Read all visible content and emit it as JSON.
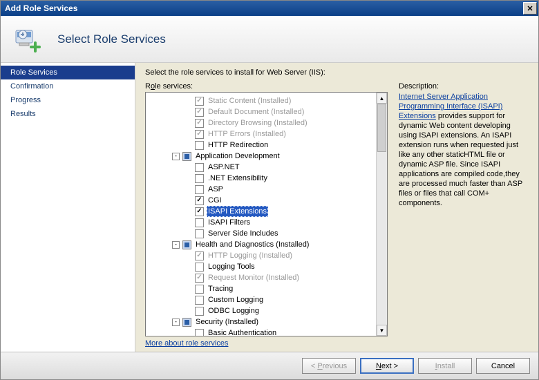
{
  "window": {
    "title": "Add Role Services"
  },
  "header": {
    "title": "Select Role Services"
  },
  "sidebar": {
    "items": [
      {
        "label": "Role Services",
        "active": true
      },
      {
        "label": "Confirmation",
        "active": false
      },
      {
        "label": "Progress",
        "active": false
      },
      {
        "label": "Results",
        "active": false
      }
    ]
  },
  "main": {
    "instruction": "Select the role services to install for Web Server (IIS):",
    "tree_label_pre": "R",
    "tree_label_u": "o",
    "tree_label_post": "le services:",
    "more_link": "More about role services"
  },
  "tree": {
    "nodes": [
      {
        "indent": 3,
        "label": "Static Content  (Installed)",
        "state": "checked",
        "disabled": true
      },
      {
        "indent": 3,
        "label": "Default Document  (Installed)",
        "state": "checked",
        "disabled": true
      },
      {
        "indent": 3,
        "label": "Directory Browsing  (Installed)",
        "state": "checked",
        "disabled": true
      },
      {
        "indent": 3,
        "label": "HTTP Errors  (Installed)",
        "state": "checked",
        "disabled": true
      },
      {
        "indent": 3,
        "label": "HTTP Redirection",
        "state": "unchecked",
        "disabled": false
      },
      {
        "indent": 2,
        "label": "Application Development",
        "state": "tri",
        "disabled": false,
        "expander": "-"
      },
      {
        "indent": 3,
        "label": "ASP.NET",
        "state": "unchecked",
        "disabled": false
      },
      {
        "indent": 3,
        "label": ".NET Extensibility",
        "state": "unchecked",
        "disabled": false
      },
      {
        "indent": 3,
        "label": "ASP",
        "state": "unchecked",
        "disabled": false
      },
      {
        "indent": 3,
        "label": "CGI",
        "state": "checked",
        "disabled": false
      },
      {
        "indent": 3,
        "label": "ISAPI Extensions",
        "state": "checked",
        "disabled": false,
        "selected": true
      },
      {
        "indent": 3,
        "label": "ISAPI Filters",
        "state": "unchecked",
        "disabled": false
      },
      {
        "indent": 3,
        "label": "Server Side Includes",
        "state": "unchecked",
        "disabled": false
      },
      {
        "indent": 2,
        "label": "Health and Diagnostics  (Installed)",
        "state": "tri",
        "disabled": false,
        "expander": "-"
      },
      {
        "indent": 3,
        "label": "HTTP Logging  (Installed)",
        "state": "checked",
        "disabled": true
      },
      {
        "indent": 3,
        "label": "Logging Tools",
        "state": "unchecked",
        "disabled": false
      },
      {
        "indent": 3,
        "label": "Request Monitor  (Installed)",
        "state": "checked",
        "disabled": true
      },
      {
        "indent": 3,
        "label": "Tracing",
        "state": "unchecked",
        "disabled": false
      },
      {
        "indent": 3,
        "label": "Custom Logging",
        "state": "unchecked",
        "disabled": false
      },
      {
        "indent": 3,
        "label": "ODBC Logging",
        "state": "unchecked",
        "disabled": false
      },
      {
        "indent": 2,
        "label": "Security  (Installed)",
        "state": "tri",
        "disabled": false,
        "expander": "-"
      },
      {
        "indent": 3,
        "label": "Basic Authentication",
        "state": "unchecked",
        "disabled": false
      }
    ]
  },
  "description": {
    "label": "Description:",
    "link_text": "Internet Server Application Programming Interface (ISAPI) Extensions",
    "body": " provides support for dynamic Web content developing using ISAPI extensions. An ISAPI extension runs when requested just like any other staticHTML file or dynamic ASP file. Since ISAPI applications are compiled code,they are processed much faster than ASP files or files that call COM+ components."
  },
  "buttons": {
    "previous_pre": "< ",
    "previous_u": "P",
    "previous_post": "revious",
    "next_u": "N",
    "next_post": "ext >",
    "install_u": "I",
    "install_post": "nstall",
    "cancel": "Cancel"
  }
}
